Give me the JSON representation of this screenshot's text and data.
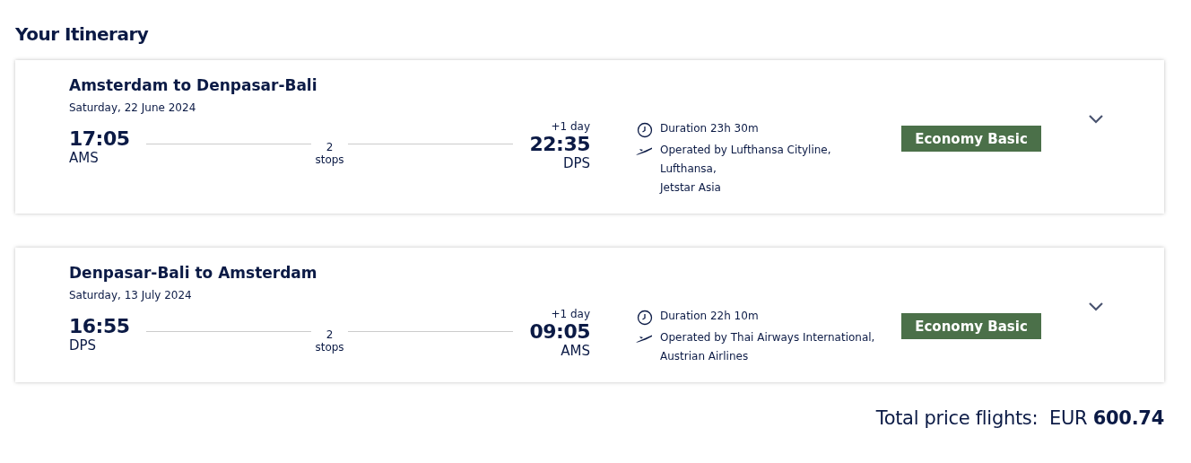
{
  "heading": "Your Itinerary",
  "flights": [
    {
      "route": "Amsterdam to Denpasar-Bali",
      "date": "Saturday, 22 June 2024",
      "depart_time": "17:05",
      "depart_code": "AMS",
      "stops_count": "2",
      "stops_label": "stops",
      "arrival_note": "+1 day",
      "arrive_time": "22:35",
      "arrive_code": "DPS",
      "duration": "Duration 23h 30m",
      "operated_by": [
        "Operated by Lufthansa Cityline,",
        "Lufthansa,",
        "Jetstar Asia"
      ],
      "fare": "Economy Basic"
    },
    {
      "route": "Denpasar-Bali to Amsterdam",
      "date": "Saturday, 13 July 2024",
      "depart_time": "16:55",
      "depart_code": "DPS",
      "stops_count": "2",
      "stops_label": "stops",
      "arrival_note": "+1 day",
      "arrive_time": "09:05",
      "arrive_code": "AMS",
      "duration": "Duration 22h 10m",
      "operated_by": [
        "Operated by Thai Airways International,",
        "Austrian Airlines"
      ],
      "fare": "Economy Basic"
    }
  ],
  "total": "Total price flights:  EUR **600.74**"
}
